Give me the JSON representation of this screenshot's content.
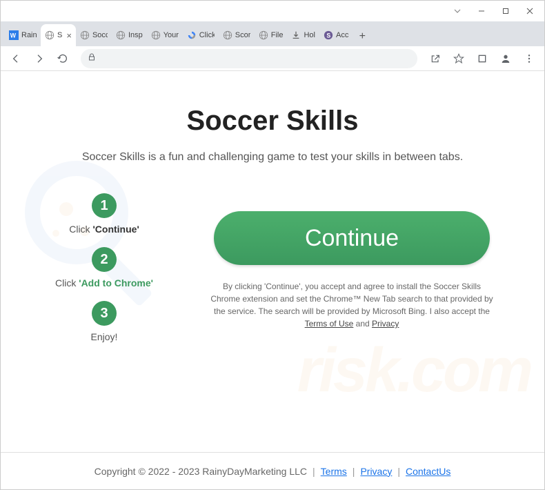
{
  "window": {
    "tabs": [
      {
        "label": "Rain",
        "favicon": "wa"
      },
      {
        "label": "S",
        "favicon": "globe",
        "active": true
      },
      {
        "label": "Socc",
        "favicon": "globe"
      },
      {
        "label": "Insp",
        "favicon": "globe"
      },
      {
        "label": "Your",
        "favicon": "globe"
      },
      {
        "label": "Click",
        "favicon": "recaptcha"
      },
      {
        "label": "Scor",
        "favicon": "globe"
      },
      {
        "label": "File",
        "favicon": "globe"
      },
      {
        "label": "Hol",
        "favicon": "download"
      },
      {
        "label": "Acc",
        "favicon": "s-purple"
      }
    ]
  },
  "page": {
    "title": "Soccer Skills",
    "subtitle": "Soccer Skills is a fun and challenging game to test your skills in between tabs.",
    "steps": [
      {
        "num": "1",
        "prefix": "Click ",
        "bold": "'Continue'",
        "boldClass": "bold"
      },
      {
        "num": "2",
        "prefix": "Click ",
        "bold": "'Add to Chrome'",
        "boldClass": "green"
      },
      {
        "num": "3",
        "prefix": "Enjoy!",
        "bold": "",
        "boldClass": ""
      }
    ],
    "cta": "Continue",
    "disclaimer": {
      "text1": "By clicking 'Continue', you accept and agree to install the Soccer Skills Chrome extension and set the Chrome™ New Tab search to that provided by the service. The search will be provided by Microsoft Bing. I also accept the ",
      "terms": "Terms of Use",
      "text2": " and ",
      "privacy": "Privacy"
    }
  },
  "footer": {
    "copyright": "Copyright © 2022 - 2023 RainyDayMarketing LLC",
    "links": [
      "Terms",
      "Privacy",
      "ContactUs"
    ]
  }
}
